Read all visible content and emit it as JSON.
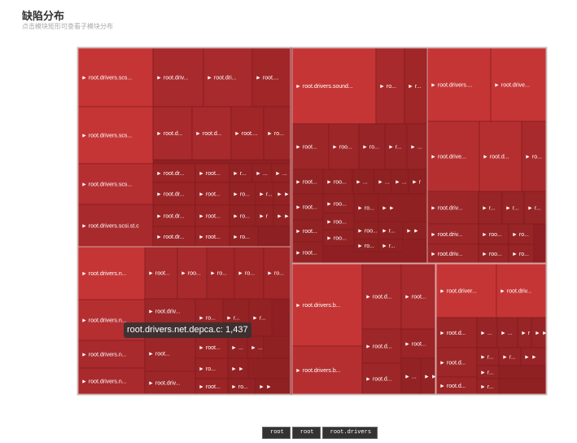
{
  "title": "缺陷分布",
  "subtitle": "点击模块矩形可查看子模块分布",
  "tooltip": "root.drivers.net.depca.c: 1,437",
  "breadcrumbs": [
    "root",
    "root",
    "root.drivers"
  ],
  "chart_data": {
    "type": "treemap",
    "title": "缺陷分布",
    "tooltip_item": {
      "name": "root.drivers.net.depca.c",
      "value": 1437
    },
    "labels": {
      "scsi": [
        "► root.drivers.scs...",
        "► root.driv...",
        "► root.dri...",
        "► root....",
        "► root.drivers.scs...",
        "► root.d...",
        "► root.d...",
        "► root....",
        "► ro...",
        "► root.drivers.scs...",
        "► root.dr...",
        "► root...",
        "► r...",
        "► ...",
        "► ...",
        "► root.dr...",
        "► root...",
        "► ro...",
        "► r...",
        "► ►",
        "► root.drivers.scsi.st.c",
        "► root.dr...",
        "► root...",
        "► ro...",
        "► r",
        "► ►",
        "► root.dr...",
        "► root...",
        "► ro..."
      ],
      "sound": [
        "► root.drivers.sound...",
        "► ro...",
        "► r...",
        "► root...",
        "► roo...",
        "► ro...",
        "► r...",
        "► ...",
        "► root...",
        "► roo...",
        "► ...",
        "► ...",
        "► ...",
        "► r",
        "► root...",
        "► roo...",
        "► ro...",
        "► ►",
        "► root...",
        "► roo...",
        "► roo...",
        "► r...",
        "► ►",
        "► root...",
        "► roo...",
        "► ro...",
        "► r..."
      ],
      "upper_right": [
        "► root.drivers....",
        "► root.drive...",
        "► root.drive...",
        "► root.d...",
        "► ro...",
        "► root.driv...",
        "► r...",
        "► r...",
        "► r...",
        "► root.driv...",
        "► roo...",
        "► ro...",
        "► root.driv...",
        "► roo...",
        "► ro..."
      ],
      "net": [
        "► root.drivers.n...",
        "► root...",
        "► roo...",
        "► ro...",
        "► ro...",
        "► ro...",
        "► root.drivers.n...",
        "► root.driv...",
        "► ro...",
        "► r...",
        "► r...",
        "► root.driv...",
        "► root...",
        "► ...",
        "► ...",
        "► root.drivers.n...",
        "► root...",
        "► ro...",
        "► ►",
        "► root...",
        "► ro...",
        "► ►",
        "► root.drivers.n...",
        "► root.driv...",
        "► root...",
        "► ro...",
        "► ►"
      ],
      "block": [
        "► root.drivers.b...",
        "► root.d...",
        "► root...",
        "► root.d...",
        "► root...",
        "► root.drivers.b...",
        "► root.d...",
        "► ...",
        "► ►"
      ],
      "lower_right": [
        "► root.driver...",
        "► root.driv...",
        "► root.d...",
        "► ...",
        "► ...",
        "► r",
        "► ►",
        "► root.d...",
        "► r...",
        "► r...",
        "► ►",
        "► root.d...",
        "► r...",
        "► ►",
        "► root.d...",
        "► r..."
      ]
    }
  }
}
